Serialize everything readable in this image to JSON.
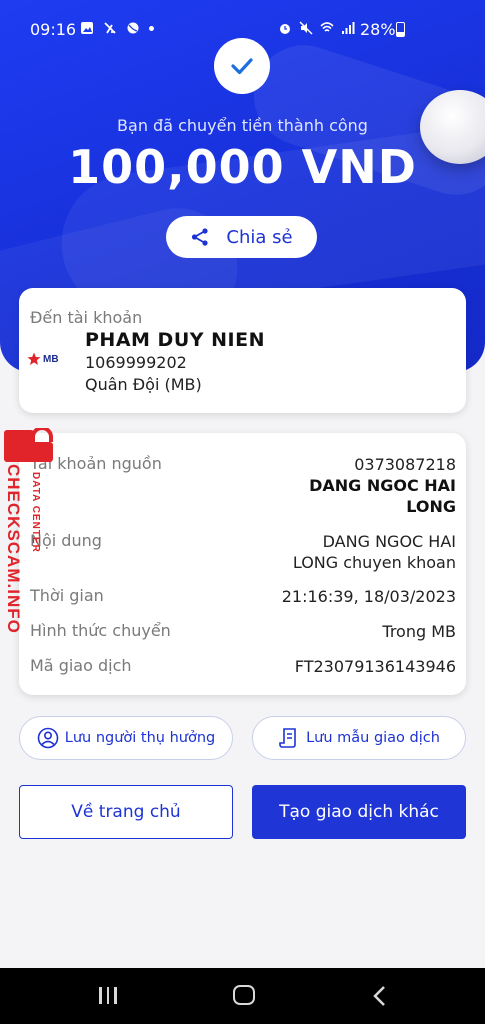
{
  "status_bar": {
    "time": "09:16",
    "battery": "28%",
    "left_icons": [
      "gallery-icon",
      "no-sim-icon",
      "ball-icon",
      "dot-icon"
    ],
    "right_icons": [
      "alarm-icon",
      "mute-icon",
      "wifi-icon",
      "signal-icon",
      "battery-icon"
    ]
  },
  "header": {
    "success_text": "Bạn đã chuyển tiền thành công",
    "amount": "100,000 VND",
    "share_label": "Chia sẻ"
  },
  "recipient": {
    "label": "Đến tài khoản",
    "bank_logo_text": "MB",
    "name": "PHAM DUY NIEN",
    "account": "1069999202",
    "bank": "Quân Đội (MB)"
  },
  "details": {
    "source_label": "Tài khoản nguồn",
    "source_account": "0373087218",
    "source_name_line1": "DANG NGOC HAI",
    "source_name_line2": "LONG",
    "content_label": "Nội dung",
    "content_line1": "DANG NGOC HAI",
    "content_line2": "LONG chuyen khoan",
    "time_label": "Thời gian",
    "time_value": "21:16:39, 18/03/2023",
    "method_label": "Hình thức chuyển",
    "method_value": "Trong MB",
    "txn_label": "Mã giao dịch",
    "txn_value": "FT23079136143946"
  },
  "watermark": {
    "main": "CHECKSCAM.INFO",
    "sub": "DATA CENTER"
  },
  "actions": {
    "save_beneficiary": "Lưu người thụ hưởng",
    "save_template": "Lưu mẫu giao dịch",
    "home": "Về trang chủ",
    "new_transaction": "Tạo giao dịch khác"
  },
  "colors": {
    "primary": "#1f35d6",
    "hero": "#1f3cf2",
    "watermark": "#e0242a"
  }
}
